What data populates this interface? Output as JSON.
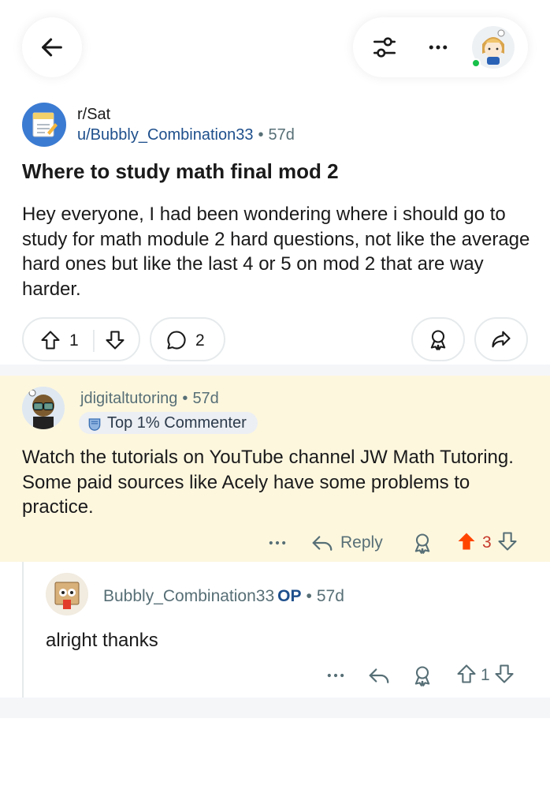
{
  "post": {
    "subreddit": "r/Sat",
    "subreddit_icon_text": "r/SAT",
    "author": "u/Bubbly_Combination33",
    "age": "57d",
    "title": "Where to study math final mod 2",
    "body": "Hey everyone, I had been wondering where i should go to study for math module 2 hard questions, not like the average hard ones but like the last 4 or 5 on mod 2 that are way harder.",
    "upvotes": "1",
    "comments": "2"
  },
  "comment": {
    "author": "jdigitaltutoring",
    "age": "57d",
    "badge": "Top 1% Commenter",
    "body": "Watch the tutorials on YouTube channel JW Math Tutoring. Some paid sources like Acely have some problems to practice.",
    "reply_label": "Reply",
    "votes": "3"
  },
  "reply": {
    "author": "Bubbly_Combination33",
    "op_tag": "OP",
    "age": "57d",
    "body": "alright thanks",
    "votes": "1"
  },
  "separator": "•",
  "colors": {
    "accent_blue": "#1e4f8c",
    "upvote_active": "#ff4500",
    "highlight_bg": "#fdf7de",
    "online": "#17c04a"
  }
}
